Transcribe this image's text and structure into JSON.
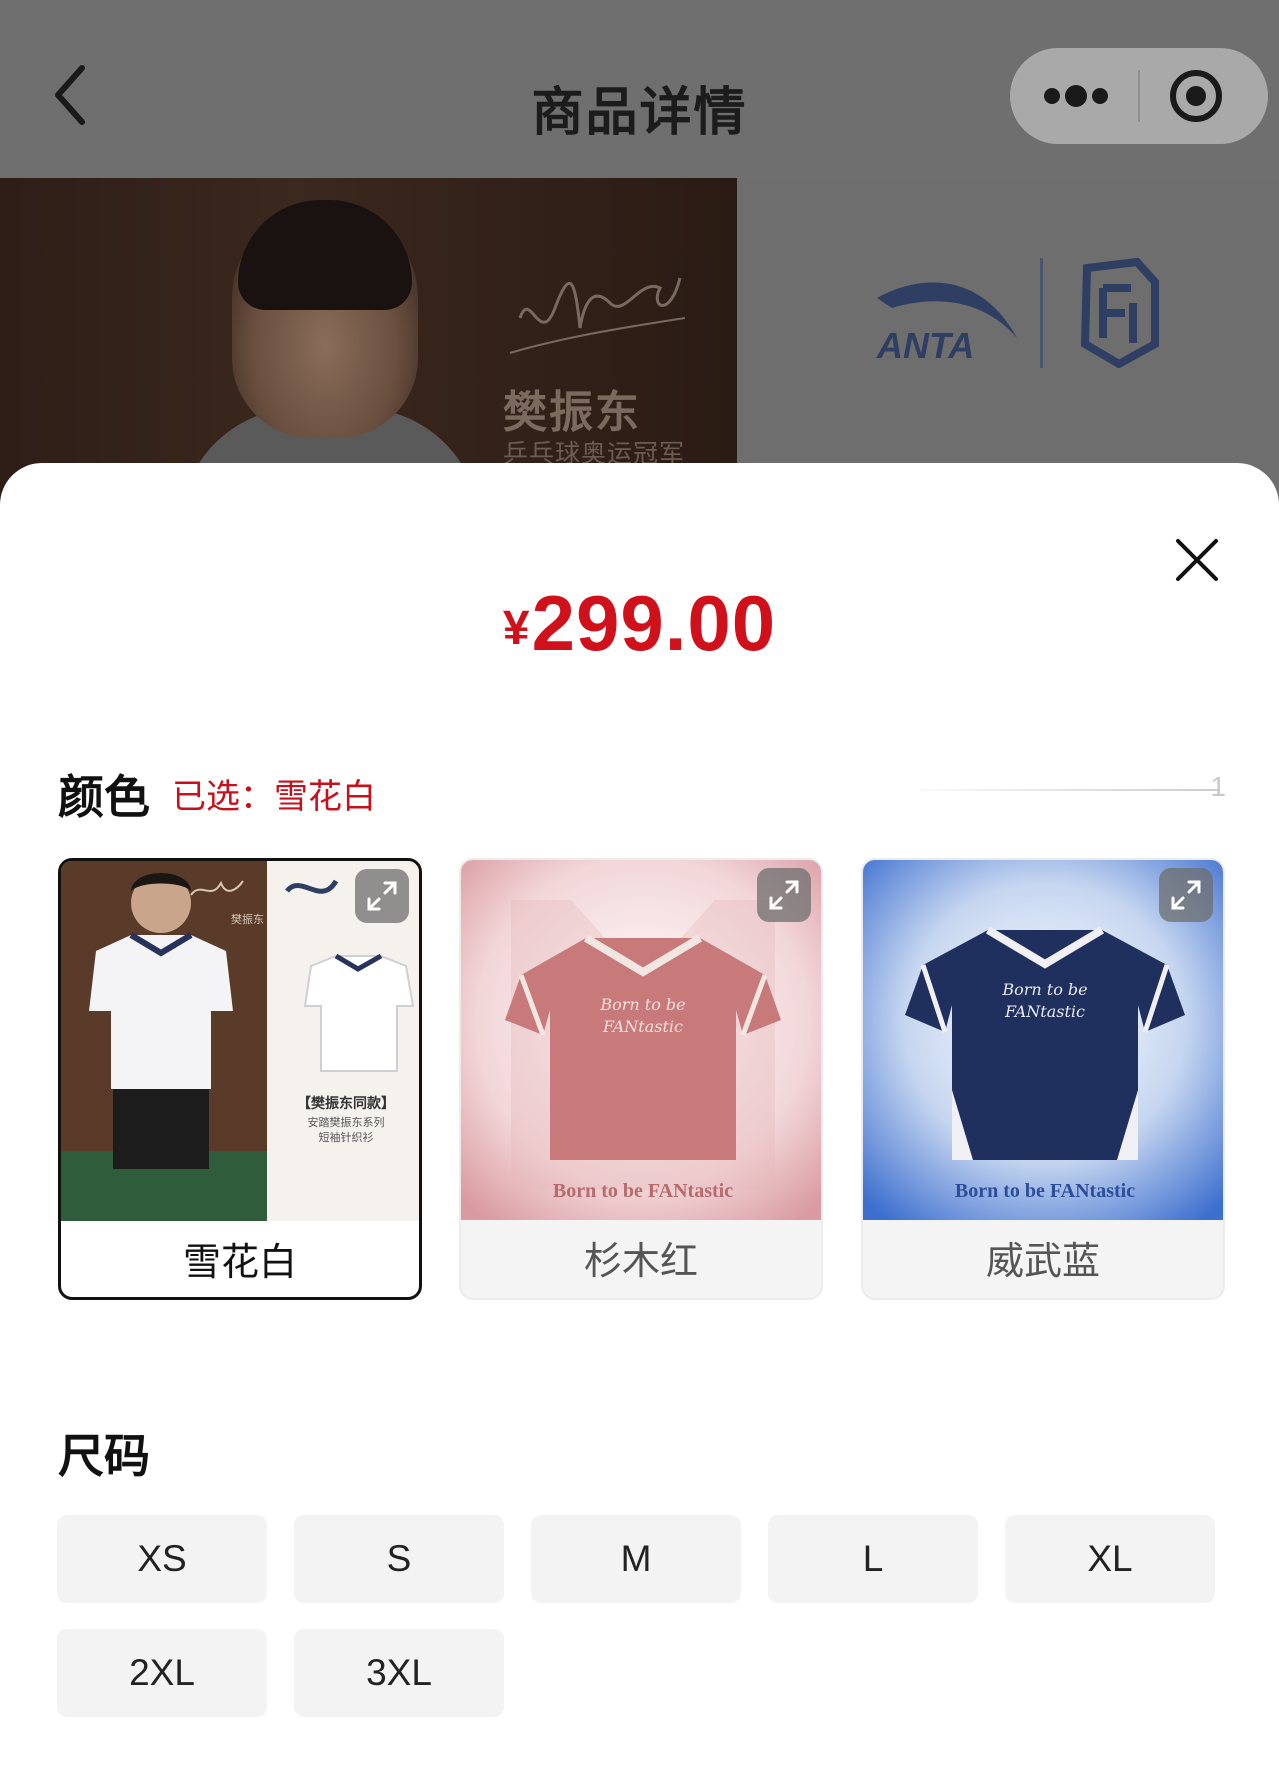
{
  "navbar": {
    "title": "商品详情",
    "back_icon": "chevron-left-icon",
    "more_icon": "more-dots-icon",
    "close_icon": "target-circle-icon"
  },
  "banner": {
    "name": "樊振东",
    "subtitle": "乒乓球奥运冠军",
    "brand": "ANTA"
  },
  "sheet": {
    "price_symbol": "¥",
    "price_value": "299.00",
    "color_heading": "颜色",
    "selected_prefix": "已选：",
    "selected_color": "雪花白",
    "slider_value": "1",
    "size_heading": "尺码",
    "colors": [
      {
        "label": "雪花白",
        "selected": true,
        "promo_title": "【樊振东同款】",
        "promo_line1": "安踏樊振东系列",
        "promo_line2": "短袖针织衫",
        "signature_name": "樊振东"
      },
      {
        "label": "杉木红",
        "selected": false,
        "caption": "Born to be FANtastic"
      },
      {
        "label": "威武蓝",
        "selected": false,
        "caption": "Born to be FANtastic"
      }
    ],
    "sizes": [
      "XS",
      "S",
      "M",
      "L",
      "XL",
      "2XL",
      "3XL"
    ]
  },
  "colors": {
    "price_red": "#d0111b",
    "selected_border": "#111111",
    "option_bg": "#f3f3f3",
    "overlay_gray": "#6e6e6e"
  }
}
